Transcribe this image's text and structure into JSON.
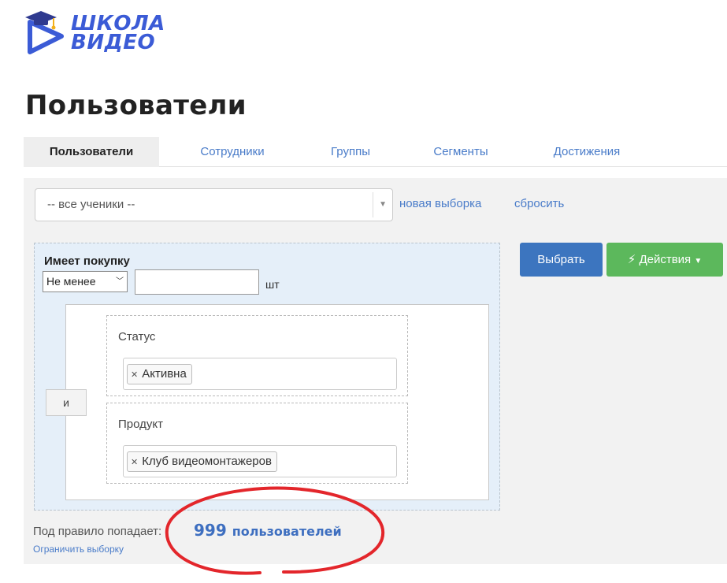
{
  "logo": {
    "line1": "ШКОЛА",
    "line2": "ВИДЕО",
    "brand_color": "#3b5bd6"
  },
  "page_title": "Пользователи",
  "tabs": [
    {
      "label": "Пользователи",
      "active": true
    },
    {
      "label": "Сотрудники",
      "active": false
    },
    {
      "label": "Группы",
      "active": false
    },
    {
      "label": "Сегменты",
      "active": false
    },
    {
      "label": "Достижения",
      "active": false
    }
  ],
  "selection": {
    "value": "-- все ученики --",
    "new_link": "новая выборка",
    "reset_link": "сбросить"
  },
  "filter": {
    "title": "Имеет покупку",
    "comparison": "Не менее",
    "quantity": "",
    "unit": "шт",
    "joiner": "и",
    "conditions": [
      {
        "label": "Статус",
        "tag": "Активна"
      },
      {
        "label": "Продукт",
        "tag": "Клуб видеомонтажеров"
      }
    ]
  },
  "buttons": {
    "select_label": "Выбрать",
    "actions_label": "Действия",
    "select_color": "#3c75bf",
    "actions_color": "#5cb85c"
  },
  "result": {
    "prefix": "Под правило попадает:",
    "count": "999",
    "count_unit": "пользователей",
    "limit_link": "Ограничить выборку"
  },
  "annotation_color": "#e3262b",
  "icons": {
    "logo": "play-graduation-cap-icon",
    "remove_tag": "close-icon",
    "actions": "lightning-icon",
    "dropdown": "caret-down-icon"
  }
}
